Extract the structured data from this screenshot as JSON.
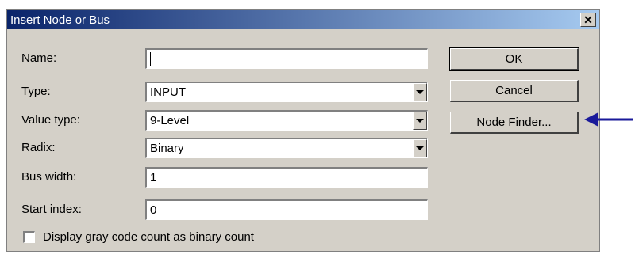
{
  "window": {
    "title": "Insert Node or Bus",
    "close_glyph": "✕"
  },
  "fields": {
    "name": {
      "label": "Name:",
      "value": ""
    },
    "type": {
      "label": "Type:",
      "value": "INPUT"
    },
    "value_type": {
      "label": "Value type:",
      "value": "9-Level"
    },
    "radix": {
      "label": "Radix:",
      "value": "Binary"
    },
    "bus_width": {
      "label": "Bus width:",
      "value": "1"
    },
    "start_index": {
      "label": "Start index:",
      "value": "0"
    }
  },
  "buttons": {
    "ok": "OK",
    "cancel": "Cancel",
    "node_finder": "Node Finder..."
  },
  "checkbox": {
    "label": "Display gray code count as binary count",
    "checked": false
  },
  "colors": {
    "arrow": "#1a1a9a",
    "title_start": "#0a246a",
    "title_end": "#a6caf0"
  }
}
